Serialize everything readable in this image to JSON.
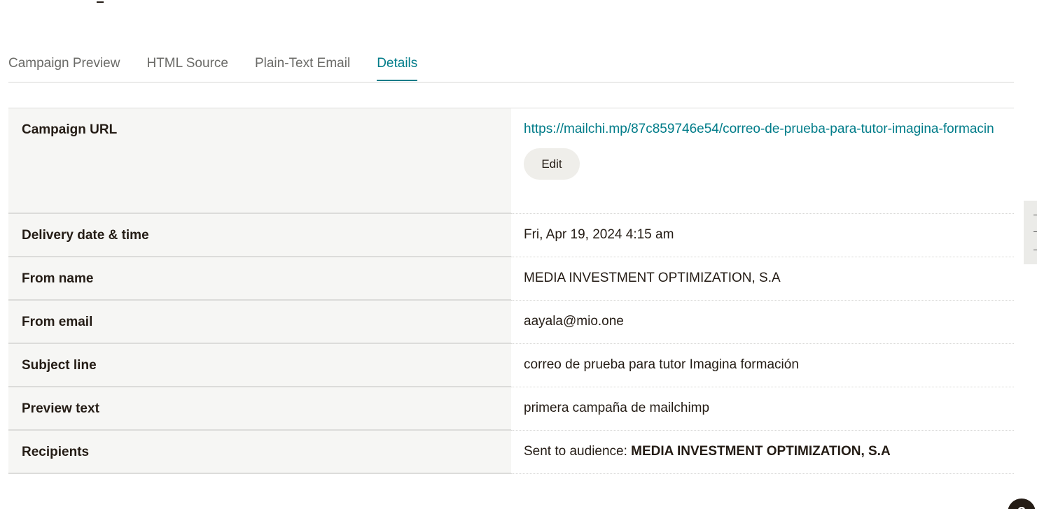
{
  "tabs": [
    {
      "label": "Campaign Preview"
    },
    {
      "label": "HTML Source"
    },
    {
      "label": "Plain-Text Email"
    },
    {
      "label": "Details"
    }
  ],
  "active_tab": "Details",
  "details": {
    "campaign_url": {
      "label": "Campaign URL",
      "value": "https://mailchi.mp/87c859746e54/correo-de-prueba-para-tutor-imagina-formacin",
      "edit_label": "Edit"
    },
    "delivery": {
      "label": "Delivery date & time",
      "value": "Fri, Apr 19, 2024 4:15 am"
    },
    "from_name": {
      "label": "From name",
      "value": "MEDIA INVESTMENT OPTIMIZATION, S.A"
    },
    "from_email": {
      "label": "From email",
      "value": "aayala@mio.one"
    },
    "subject": {
      "label": "Subject line",
      "value": "correo de prueba para tutor Imagina formación"
    },
    "preview_text": {
      "label": "Preview text",
      "value": "primera campaña de mailchimp"
    },
    "recipients": {
      "label": "Recipients",
      "prefix": "Sent to audience: ",
      "audience": "MEDIA INVESTMENT OPTIMIZATION, S.A"
    }
  },
  "help_button": {
    "label": "?"
  },
  "colors": {
    "accent": "#007c89",
    "label_bg": "#f6f6f4",
    "text": "#241c15"
  }
}
